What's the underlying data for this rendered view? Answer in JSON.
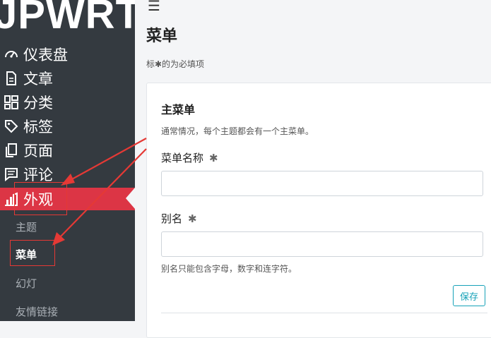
{
  "brand": "JPWRT",
  "sidebar": {
    "items": [
      {
        "label": "仪表盘",
        "icon": "dashboard-gauge-icon"
      },
      {
        "label": "文章",
        "icon": "document-icon"
      },
      {
        "label": "分类",
        "icon": "grid-icon"
      },
      {
        "label": "标签",
        "icon": "tag-icon"
      },
      {
        "label": "页面",
        "icon": "pages-icon"
      },
      {
        "label": "评论",
        "icon": "comment-icon"
      },
      {
        "label": "外观",
        "icon": "appearance-icon",
        "active": true
      }
    ],
    "sub_items": [
      {
        "label": "主题"
      },
      {
        "label": "菜单",
        "current": true
      },
      {
        "label": "幻灯"
      },
      {
        "label": "友情链接"
      }
    ]
  },
  "header": {
    "menu_icon": "☰",
    "title": "菜单",
    "required_note": "标✱的为必填项"
  },
  "card": {
    "title": "主菜单",
    "description": "通常情况，每个主题都会有一个主菜单。",
    "fields": [
      {
        "label": "菜单名称",
        "required_mark": "✱",
        "value": "",
        "placeholder": ""
      },
      {
        "label": "别名",
        "required_mark": "✱",
        "value": "",
        "placeholder": ""
      }
    ],
    "help_text": "别名只能包含字母，数字和连字符。",
    "save_label": "保存"
  },
  "colors": {
    "sidebar_bg": "#343a40",
    "active_bg": "#dc3545",
    "accent": "#17a2b8",
    "annotation": "#e53935"
  }
}
